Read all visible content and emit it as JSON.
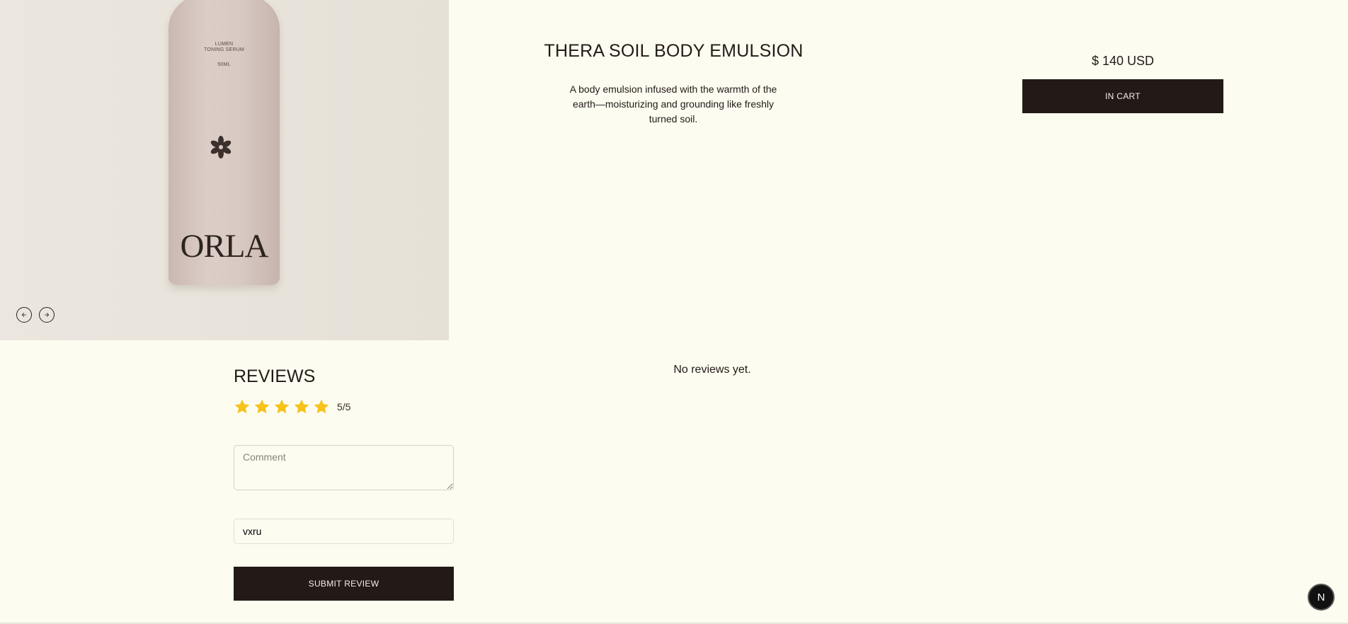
{
  "gallery": {
    "bottle_label": {
      "line1": "LUMEN",
      "line2": "TONING SERUM",
      "volume": "50ML",
      "brand": "ORLA"
    },
    "prev_icon": "arrow-left-icon",
    "next_icon": "arrow-right-icon"
  },
  "product": {
    "title": "THERA SOIL BODY EMULSION",
    "description": "A body emulsion infused with the warmth of the earth—moisturizing and grounding like freshly turned soil.",
    "price": "$ 140 USD",
    "cart_button": "IN CART"
  },
  "reviews": {
    "heading": "REVIEWS",
    "rating": 5,
    "max_rating": 5,
    "rating_text": "5/5",
    "star_color": "#f6c21b",
    "comment_placeholder": "Comment",
    "name_value": "vxru",
    "submit_label": "SUBMIT REVIEW",
    "empty_message": "No reviews yet."
  },
  "dev_badge": {
    "label": "N"
  },
  "colors": {
    "background": "#fcfcf0",
    "primary_dark": "#231a17"
  }
}
